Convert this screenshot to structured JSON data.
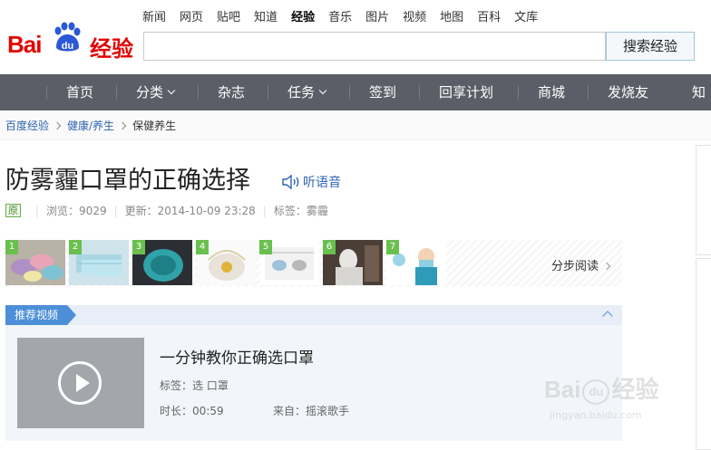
{
  "logo": {
    "bai": "Bai",
    "du": "du",
    "suffix": "经验"
  },
  "topnav": [
    "新闻",
    "网页",
    "贴吧",
    "知道",
    "经验",
    "音乐",
    "图片",
    "视频",
    "地图",
    "百科",
    "文库"
  ],
  "topnav_active": "经验",
  "search": {
    "value": "",
    "button": "搜索经验"
  },
  "mainnav": [
    {
      "label": "首页"
    },
    {
      "label": "分类"
    },
    {
      "label": "杂志"
    },
    {
      "label": "任务"
    },
    {
      "label": "签到"
    },
    {
      "label": "回享计划"
    },
    {
      "label": "商城"
    },
    {
      "label": "发烧友"
    },
    {
      "label": "知道"
    }
  ],
  "breadcrumb": [
    "百度经验",
    "健康/养生",
    "保健养生"
  ],
  "article": {
    "title": "防雾霾口罩的正确选择",
    "listen": "听语音",
    "badge": "原",
    "views": "浏览：9029",
    "updated": "更新：2014-10-09 23:28",
    "tags": "标签：雾霾"
  },
  "steps": {
    "numbers": [
      "1",
      "2",
      "3",
      "4",
      "5",
      "6",
      "7"
    ],
    "read_label": "分步阅读"
  },
  "video": {
    "section_label": "推荐视频",
    "title": "一分钟教你正确选口罩",
    "tags": "标签：选 口罩",
    "duration": "时长：00:59",
    "source": "来自：摇滚歌手"
  },
  "watermark": {
    "line1": "Bai",
    "line2": "jingyan.baidu.com",
    "suffix": "经验"
  },
  "colors": {
    "brand_red": "#e10602",
    "nav_bg": "#5b5e66",
    "link_blue": "#2d64b3",
    "step_green": "#6ac04f",
    "video_blue": "#4c8fd8"
  }
}
